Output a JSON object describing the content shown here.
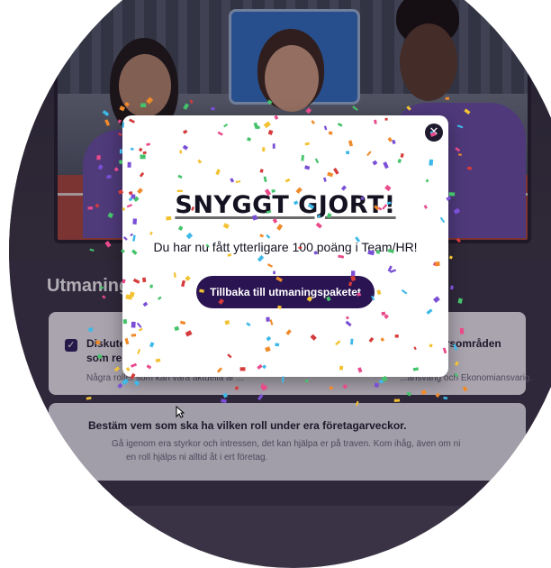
{
  "section": {
    "title": "Utmaning"
  },
  "cards": [
    {
      "checked": true,
      "title_part1": "Diskute",
      "title_part2": "som res",
      "title_part3": "arsområden",
      "desc_part1": "Några roller som kan vara aktuella är ...",
      "desc_part2": "...ansvarig och Ekonomiansvarig."
    },
    {
      "title": "Bestäm vem som ska ha vilken roll under era företagarveckor.",
      "desc_line1": "Gå igenom era styrkor och intressen, det kan hjälpa er på traven. Kom ihåg, även om ni",
      "desc_line2": "en roll hjälps ni alltid åt i ert företag."
    }
  ],
  "modal": {
    "close_symbol": "✕",
    "headline": "SNYGGT GJORT!",
    "message": "Du har nu fått ytterligare 100 poäng i Team/HR!",
    "cta_label": "Tillbaka till utmaningspaketet"
  },
  "confetti_colors": [
    "#e84a8a",
    "#f3c233",
    "#3fb9e8",
    "#7a4fd6",
    "#45c36b",
    "#f08a2a",
    "#d63b3b"
  ],
  "colors": {
    "modal_button": "#2a1452",
    "headline_underline": "#6a6a6a",
    "accent_purple": "#6a4fa6"
  },
  "icons": {
    "close": "close-icon",
    "check": "checkbox-checked-icon",
    "cursor": "mouse-pointer-icon"
  }
}
